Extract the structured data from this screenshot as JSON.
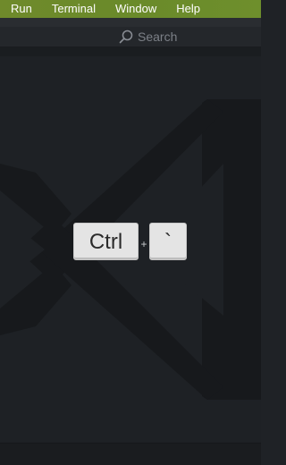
{
  "menubar": {
    "items": [
      {
        "label": "Run"
      },
      {
        "label": "Terminal"
      },
      {
        "label": "Window"
      },
      {
        "label": "Help"
      }
    ]
  },
  "toolbar": {
    "search": {
      "icon": "search-icon",
      "placeholder": "Search"
    }
  },
  "editor": {
    "watermark_icon": "vscode-logo-icon",
    "shortcut": {
      "keys": [
        "Ctrl",
        "`"
      ],
      "separator": "+"
    }
  },
  "colors": {
    "menubar": "#6c8a2b",
    "editor_background": "#1e2125",
    "watermark": "#181a1d",
    "keycap": "#e4e4e4"
  }
}
